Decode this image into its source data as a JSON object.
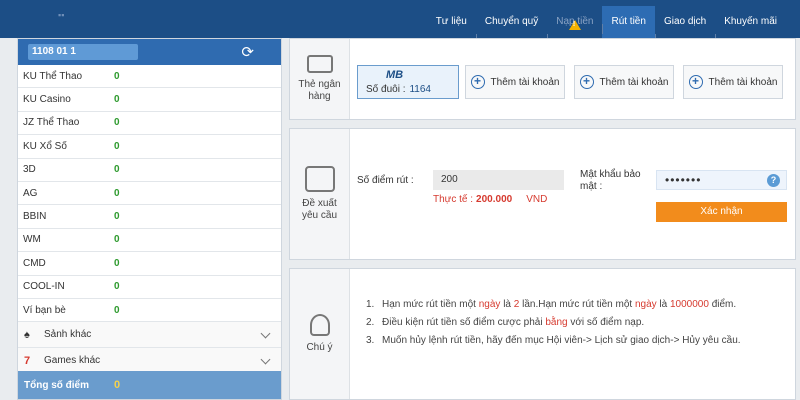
{
  "nav": {
    "items": [
      {
        "label": "Tư liệu",
        "state": "normal"
      },
      {
        "label": "Chuyển quỹ",
        "state": "normal"
      },
      {
        "label": "Nạp tiền",
        "state": "disabled"
      },
      {
        "label": "Rút tiền",
        "state": "active"
      },
      {
        "label": "Giao dịch",
        "state": "normal"
      },
      {
        "label": "Khuyến mãi",
        "state": "normal"
      }
    ],
    "warning_icon": "warning-icon"
  },
  "sidebar": {
    "balance_badge": "1108 01 1",
    "refresh_icon": "refresh-icon",
    "accounts": [
      {
        "name": "KU Thể Thao",
        "value": "0"
      },
      {
        "name": "KU Casino",
        "value": "0"
      },
      {
        "name": "JZ Thể Thao",
        "value": "0"
      },
      {
        "name": "KU Xổ Số",
        "value": "0"
      },
      {
        "name": "3D",
        "value": "0"
      },
      {
        "name": "AG",
        "value": "0"
      },
      {
        "name": "BBIN",
        "value": "0"
      },
      {
        "name": "WM",
        "value": "0"
      },
      {
        "name": "CMD",
        "value": "0"
      },
      {
        "name": "COOL-IN",
        "value": "0"
      },
      {
        "name": "Ví bạn bè",
        "value": "0"
      }
    ],
    "groups": [
      {
        "label": "Sảnh khác",
        "icon": "spade-icon"
      },
      {
        "label": "Games khác",
        "icon": "seven-icon"
      }
    ],
    "total_label": "Tổng số điểm",
    "total_value": "0"
  },
  "bank": {
    "side_label_1": "Thẻ ngân",
    "side_label_2": "hàng",
    "card_logo": "MB",
    "card_suffix_label": "Số đuôi :",
    "card_suffix": "1164",
    "add_buttons": [
      "Thêm tài khoản",
      "Thêm tài khoản",
      "Thêm tài khoản"
    ]
  },
  "withdraw": {
    "side_label_1": "Đề xuất",
    "side_label_2": "yêu cầu",
    "amount_label": "Số điểm rút :",
    "amount_value": "200",
    "actual_label": "Thực tế :",
    "actual_value": "200.000",
    "actual_unit": "VND",
    "password_label_1": "Mật khẩu bảo",
    "password_label_2": "mật :",
    "password_value": "•••••••",
    "confirm_label": "Xác nhận"
  },
  "notes": {
    "side_label": "Chú ý",
    "items": [
      {
        "num": "1.",
        "parts": [
          "Hạn mức rút tiền một ",
          "ngày",
          " là ",
          "2",
          " lần.Hạn mức rút tiền một ",
          "ngày",
          " là ",
          "1000000",
          " điểm."
        ]
      },
      {
        "num": "2.",
        "parts": [
          "Điều kiện rút tiền số điểm cược phải ",
          "bằng",
          " với số điểm nạp."
        ]
      },
      {
        "num": "3.",
        "text": "Muốn hủy lệnh rút tiền, hãy đến mục Hội viên-> Lịch sử giao dịch-> Hủy yêu cầu."
      }
    ]
  },
  "colors": {
    "nav_bg": "#1c4e86",
    "nav_active": "#2d6cb3",
    "accent_orange": "#f28c1c",
    "value_green": "#2e9a2e",
    "highlight_red": "#d63a2f"
  }
}
